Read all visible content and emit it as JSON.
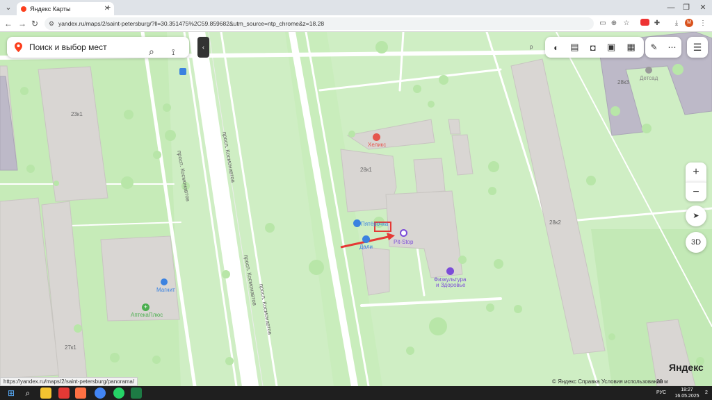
{
  "browser": {
    "tab_title": "Яндекс Карты",
    "tab_close": "✕",
    "new_tab": "+",
    "tab_dropdown": "⌄",
    "minimize": "—",
    "restore": "❐",
    "close": "✕",
    "url": "yandex.ru/maps/2/saint-petersburg/?ll=30.351475%2C59.859682&utm_source=ntp_chrome&z=18.28",
    "back": "←",
    "forward": "→",
    "reload": "↻",
    "profile_initial": "М"
  },
  "map": {
    "search_placeholder": "Поиск и выбор мест",
    "collapse_glyph": "‹",
    "zoom_in": "+",
    "zoom_out": "−",
    "locate_glyph": "➤",
    "view_3d": "3D",
    "menu_glyph": "☰",
    "streets": {
      "prospect_1": "просп. Космонавтов",
      "prospect_2": "просп. Космонавтов",
      "prospect_3": "просп. Космонавтов",
      "prospect_4": "просп. Космонавтов",
      "road_letter": "р"
    },
    "buildings": {
      "b23k1": "23к1",
      "b28k1": "28к1",
      "b28k2": "28к2",
      "b28k3": "28к3",
      "b27k1": "27к1"
    },
    "pois": {
      "helix": "Хеликс",
      "pyaterochka": "Пятёрочка",
      "dali": "Дали",
      "pitstop": "Pit-Stop",
      "fitness_1": "Физкультура",
      "fitness_2": "и Здоровье",
      "magnit": "Магнит",
      "apteka": "АптекаПлюс",
      "detsad": "Детсад"
    },
    "logo": "Яндекс",
    "attribution": "© Яндекс   Справка   Условия использования",
    "scale_label": "20 м",
    "status_url": "https://yandex.ru/maps/2/saint-petersburg/panorama/"
  },
  "colors": {
    "grass": "#cfeec4",
    "road": "#ffffff",
    "building": "#d9d6d3",
    "building_dark": "#bdb9c8",
    "annotation": "#e53935",
    "poi_blue": "#3b82e0",
    "poi_purple": "#7b4cd8"
  },
  "taskbar": {
    "lang": "РУС",
    "time": "18:27",
    "date": "16.05.2025",
    "notif_count": "2"
  }
}
